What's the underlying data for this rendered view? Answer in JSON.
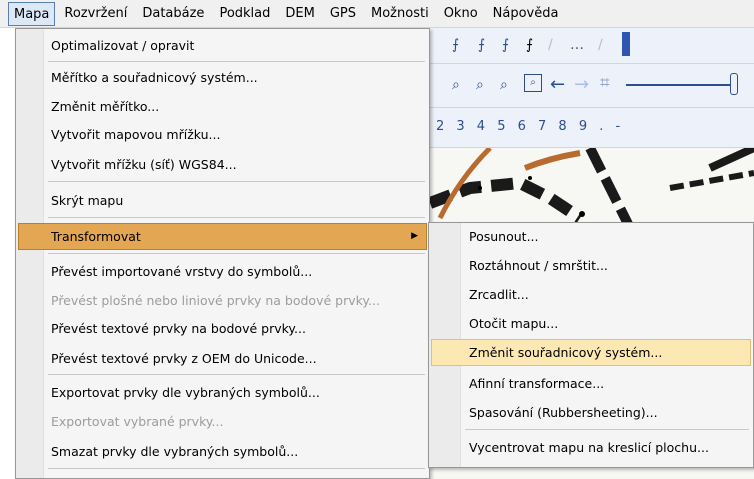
{
  "menubar": {
    "items": [
      "Mapa",
      "Rozvržení",
      "Databáze",
      "Podklad",
      "DEM",
      "GPS",
      "Možnosti",
      "Okno",
      "Nápověda"
    ]
  },
  "toolbar": {
    "digits": "2 3 4 5 6 7 8 9 . -"
  },
  "mapa_menu": {
    "items": [
      "Optimalizovat / opravit",
      "Měřítko a souřadnicový systém...",
      "Změnit měřítko...",
      "Vytvořit mapovou mřížku...",
      "Vytvořit mřížku (síť) WGS84...",
      "Skrýt mapu",
      "Transformovat",
      "Převést importované vrstvy do symbolů...",
      "Převést plošné nebo liniové prvky na bodové prvky...",
      "Převést textové prvky na bodové prvky...",
      "Převést textové prvky z OEM do Unicode...",
      "Exportovat prvky dle vybraných symbolů...",
      "Exportovat vybrané prvky...",
      "Smazat prvky dle vybraných symbolů..."
    ],
    "disabled": [
      "Převést plošné nebo liniové prvky na bodové prvky...",
      "Exportovat vybrané prvky..."
    ]
  },
  "transform_submenu": {
    "items": [
      "Posunout...",
      "Roztáhnout / smrštit...",
      "Zrcadlit...",
      "Otočit mapu...",
      "Změnit souřadnicový systém...",
      "Afinní transformace...",
      "Spasování (Rubbersheeting)...",
      "Vycentrovat mapu na kreslicí plochu..."
    ]
  },
  "colors": {
    "menu_highlight": "#e3a653",
    "submenu_highlight": "#fce8b3",
    "toolbar_icon": "#2b4f8e",
    "map_track": "#b86a2f"
  }
}
